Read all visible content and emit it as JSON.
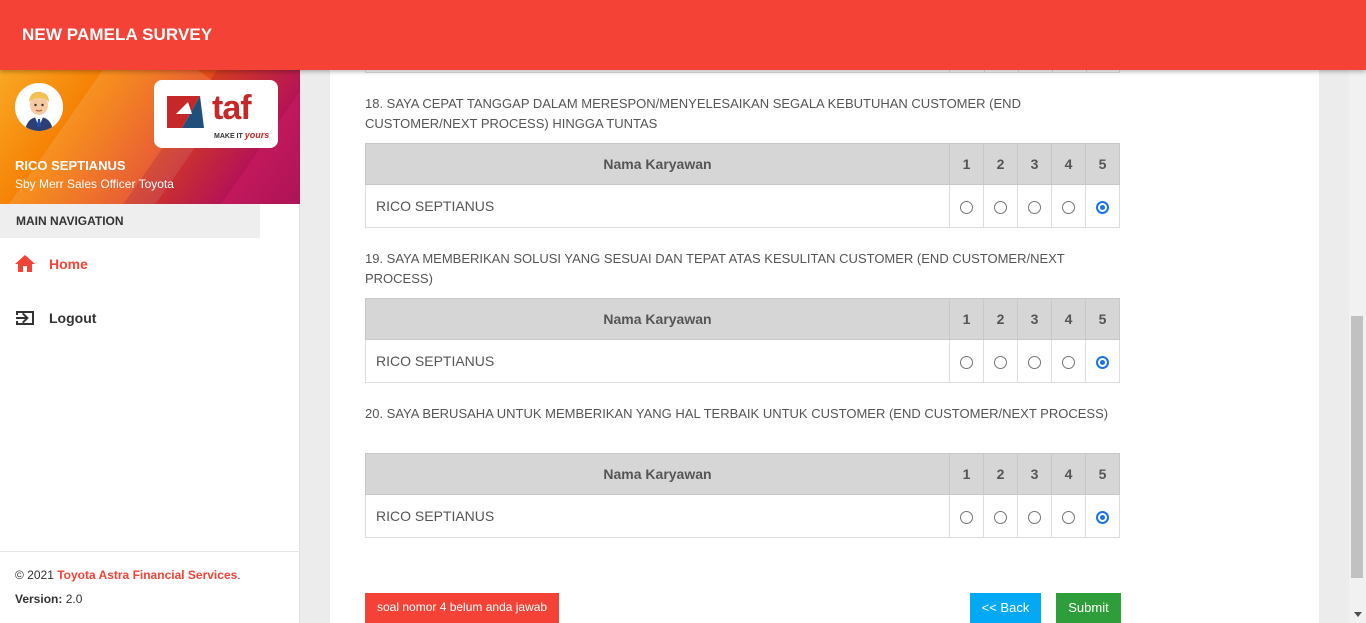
{
  "app": {
    "title": "NEW PAMELA SURVEY"
  },
  "user": {
    "name": "RICO SEPTIANUS",
    "role": "Sby Merr Sales Officer Toyota"
  },
  "brand": {
    "logo_text": "taf",
    "tagline_a": "MAKE IT",
    "tagline_b": "yours"
  },
  "nav": {
    "header": "MAIN NAVIGATION",
    "items": [
      {
        "label": "Home",
        "icon": "home-icon",
        "active": true
      },
      {
        "label": "Logout",
        "icon": "logout-icon",
        "active": false
      }
    ]
  },
  "footer": {
    "copyright_prefix": "© 2021",
    "company": "Toyota Astra Financial Services",
    "suffix": ".",
    "version_label": "Version:",
    "version_value": "2.0"
  },
  "table_headers": {
    "name": "Nama Karyawan",
    "scores": [
      "1",
      "2",
      "3",
      "4",
      "5"
    ]
  },
  "questions": [
    {
      "text": "18. SAYA CEPAT TANGGAP DALAM MERESPON/MENYELESAIKAN SEGALA KEBUTUHAN CUSTOMER (END CUSTOMER/NEXT PROCESS) HINGGA TUNTAS",
      "employee": "RICO SEPTIANUS",
      "selected": 5
    },
    {
      "text": "19. SAYA MEMBERIKAN SOLUSI YANG SESUAI DAN TEPAT ATAS KESULITAN CUSTOMER (END CUSTOMER/NEXT PROCESS)",
      "employee": "RICO SEPTIANUS",
      "selected": 5
    },
    {
      "text": "20. SAYA BERUSAHA UNTUK MEMBERIKAN YANG HAL TERBAIK UNTUK CUSTOMER (END CUSTOMER/NEXT PROCESS)",
      "employee": "RICO SEPTIANUS",
      "selected": 5
    }
  ],
  "actions": {
    "warning": "soal nomor 4 belum anda jawab",
    "back": "<< Back",
    "submit": "Submit"
  },
  "colors": {
    "topbar": "#f44336",
    "back": "#03a9f4",
    "submit": "#2e9e3a",
    "radio_checked": "#1a73e8"
  }
}
